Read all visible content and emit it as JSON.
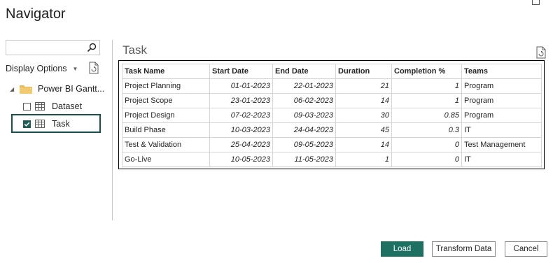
{
  "window": {
    "title": "Navigator"
  },
  "left_pane": {
    "search": {
      "value": "",
      "placeholder": ""
    },
    "display_options_label": "Display Options",
    "tree": {
      "root_label": "Power BI Gantt...",
      "items": [
        {
          "label": "Dataset",
          "checked": false
        },
        {
          "label": "Task",
          "checked": true,
          "selected": true
        }
      ]
    }
  },
  "preview": {
    "title": "Task",
    "columns": [
      "Task Name",
      "Start Date",
      "End Date",
      "Duration",
      "Completion %",
      "Teams"
    ],
    "rows": [
      [
        "Project Planning",
        "01-01-2023",
        "22-01-2023",
        "21",
        "1",
        "Program"
      ],
      [
        "Project Scope",
        "23-01-2023",
        "06-02-2023",
        "14",
        "1",
        "Program"
      ],
      [
        "Project Design",
        "07-02-2023",
        "09-03-2023",
        "30",
        "0.85",
        "Program"
      ],
      [
        "Build Phase",
        "10-03-2023",
        "24-04-2023",
        "45",
        "0.3",
        "IT"
      ],
      [
        "Test & Validation",
        "25-04-2023",
        "09-05-2023",
        "14",
        "0",
        "Test Management"
      ],
      [
        "Go-Live",
        "10-05-2023",
        "11-05-2023",
        "1",
        "0",
        "IT"
      ]
    ]
  },
  "footer": {
    "load_label": "Load",
    "transform_label": "Transform Data",
    "cancel_label": "Cancel"
  },
  "colors": {
    "accent": "#1e7062",
    "selection_border": "#19504b"
  }
}
